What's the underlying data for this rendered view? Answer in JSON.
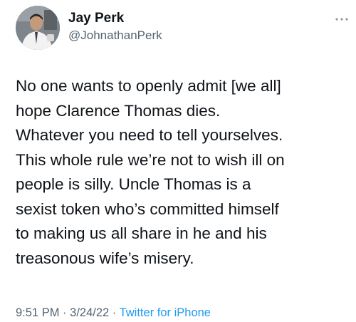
{
  "author": {
    "display_name": "Jay Perk",
    "handle": "@JohnathanPerk",
    "avatar": "profile-photo"
  },
  "more_icon": "more-dots-icon",
  "tweet": {
    "lines": [
      "No one wants to openly admit [we all]",
      "hope Clarence Thomas dies.",
      "Whatever you need to tell yourselves.",
      "This whole rule we’re not to wish ill on",
      "people is silly. Uncle Thomas is a",
      "sexist token who’s committed himself",
      "to making us all share in he and his",
      "treasonous wife’s misery."
    ]
  },
  "meta": {
    "time": "9:51 PM",
    "separator": "·",
    "date": "3/24/22",
    "source": "Twitter for iPhone"
  },
  "colors": {
    "text": "#0f1419",
    "secondary": "#536471",
    "link": "#1d9bf0"
  }
}
